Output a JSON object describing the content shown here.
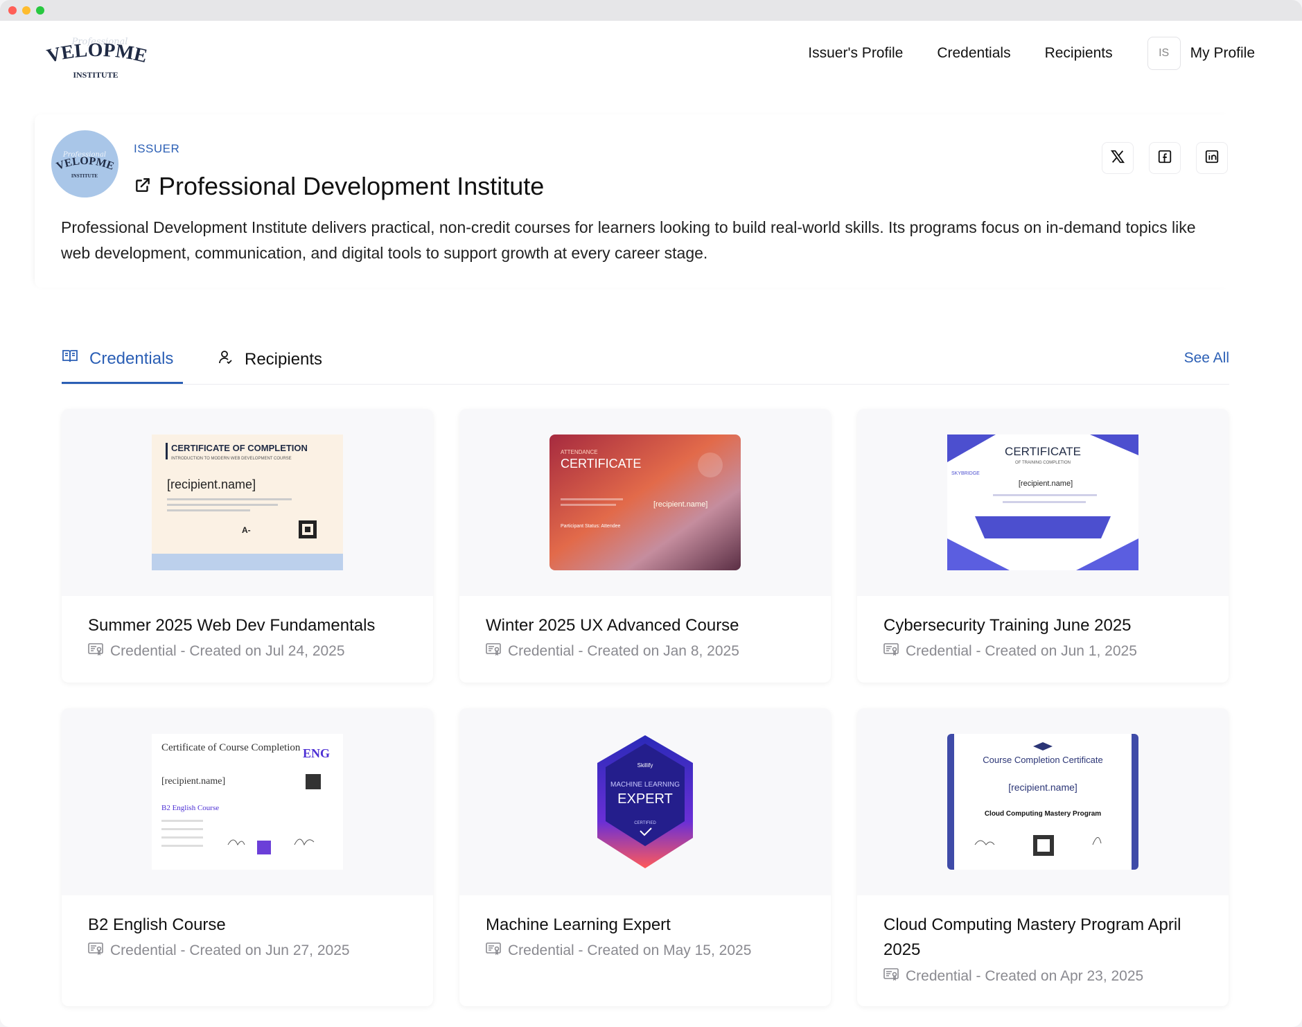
{
  "nav": {
    "links": [
      "Issuer's Profile",
      "Credentials",
      "Recipients"
    ],
    "avatar_initials": "IS",
    "my_profile": "My Profile"
  },
  "issuer": {
    "label": "ISSUER",
    "name": "Professional Development Institute",
    "description": "Professional Development Institute delivers practical, non-credit courses for learners looking to build real-world skills. Its programs focus on in-demand topics like web development, communication, and digital tools to support growth at every career stage."
  },
  "tabs": {
    "credentials": "Credentials",
    "recipients": "Recipients",
    "see_all": "See All"
  },
  "cards": [
    {
      "title": "Summer 2025 Web Dev Fundamentals",
      "meta": "Credential - Created on Jul 24, 2025"
    },
    {
      "title": "Winter 2025 UX Advanced Course",
      "meta": "Credential - Created on Jan 8, 2025"
    },
    {
      "title": "Cybersecurity Training June 2025",
      "meta": "Credential - Created on Jun 1, 2025"
    },
    {
      "title": "B2 English Course",
      "meta": "Credential - Created on Jun 27, 2025"
    },
    {
      "title": "Machine Learning Expert",
      "meta": "Credential - Created on May 15, 2025"
    },
    {
      "title": "Cloud Computing Mastery Program April 2025",
      "meta": "Credential - Created on Apr 23, 2025"
    }
  ],
  "thumbs": {
    "c1": {
      "title": "CERTIFICATE OF COMPLETION",
      "sub": "INTRODUCTION TO MODERN WEB DEVELOPMENT COURSE",
      "recipient": "[recipient.name]",
      "grade": "A-"
    },
    "c2": {
      "kicker": "ATTENDANCE",
      "title": "CERTIFICATE",
      "recipient": "[recipient.name]",
      "status": "Participant Status: Attendee"
    },
    "c3": {
      "title": "CERTIFICATE",
      "sub": "OF TRAINING COMPLETION",
      "recipient": "[recipient.name]",
      "brand": "SKYBRIDGE"
    },
    "c4": {
      "title": "Certificate of Course Completion",
      "recipient": "[recipient.name]",
      "course": "B2 English Course",
      "badge": "ENG"
    },
    "c5": {
      "brand": "Skillify",
      "line1": "MACHINE LEARNING",
      "line2": "EXPERT",
      "line3": "CERTIFIED"
    },
    "c6": {
      "title": "Course Completion Certificate",
      "recipient": "[recipient.name]",
      "program": "Cloud Computing Mastery Program"
    }
  },
  "logo": {
    "line1": "DEVELOPMENT",
    "line2": "INSTITUTE"
  },
  "colors": {
    "accent": "#2b5fb5",
    "meta": "#8a8a90"
  }
}
